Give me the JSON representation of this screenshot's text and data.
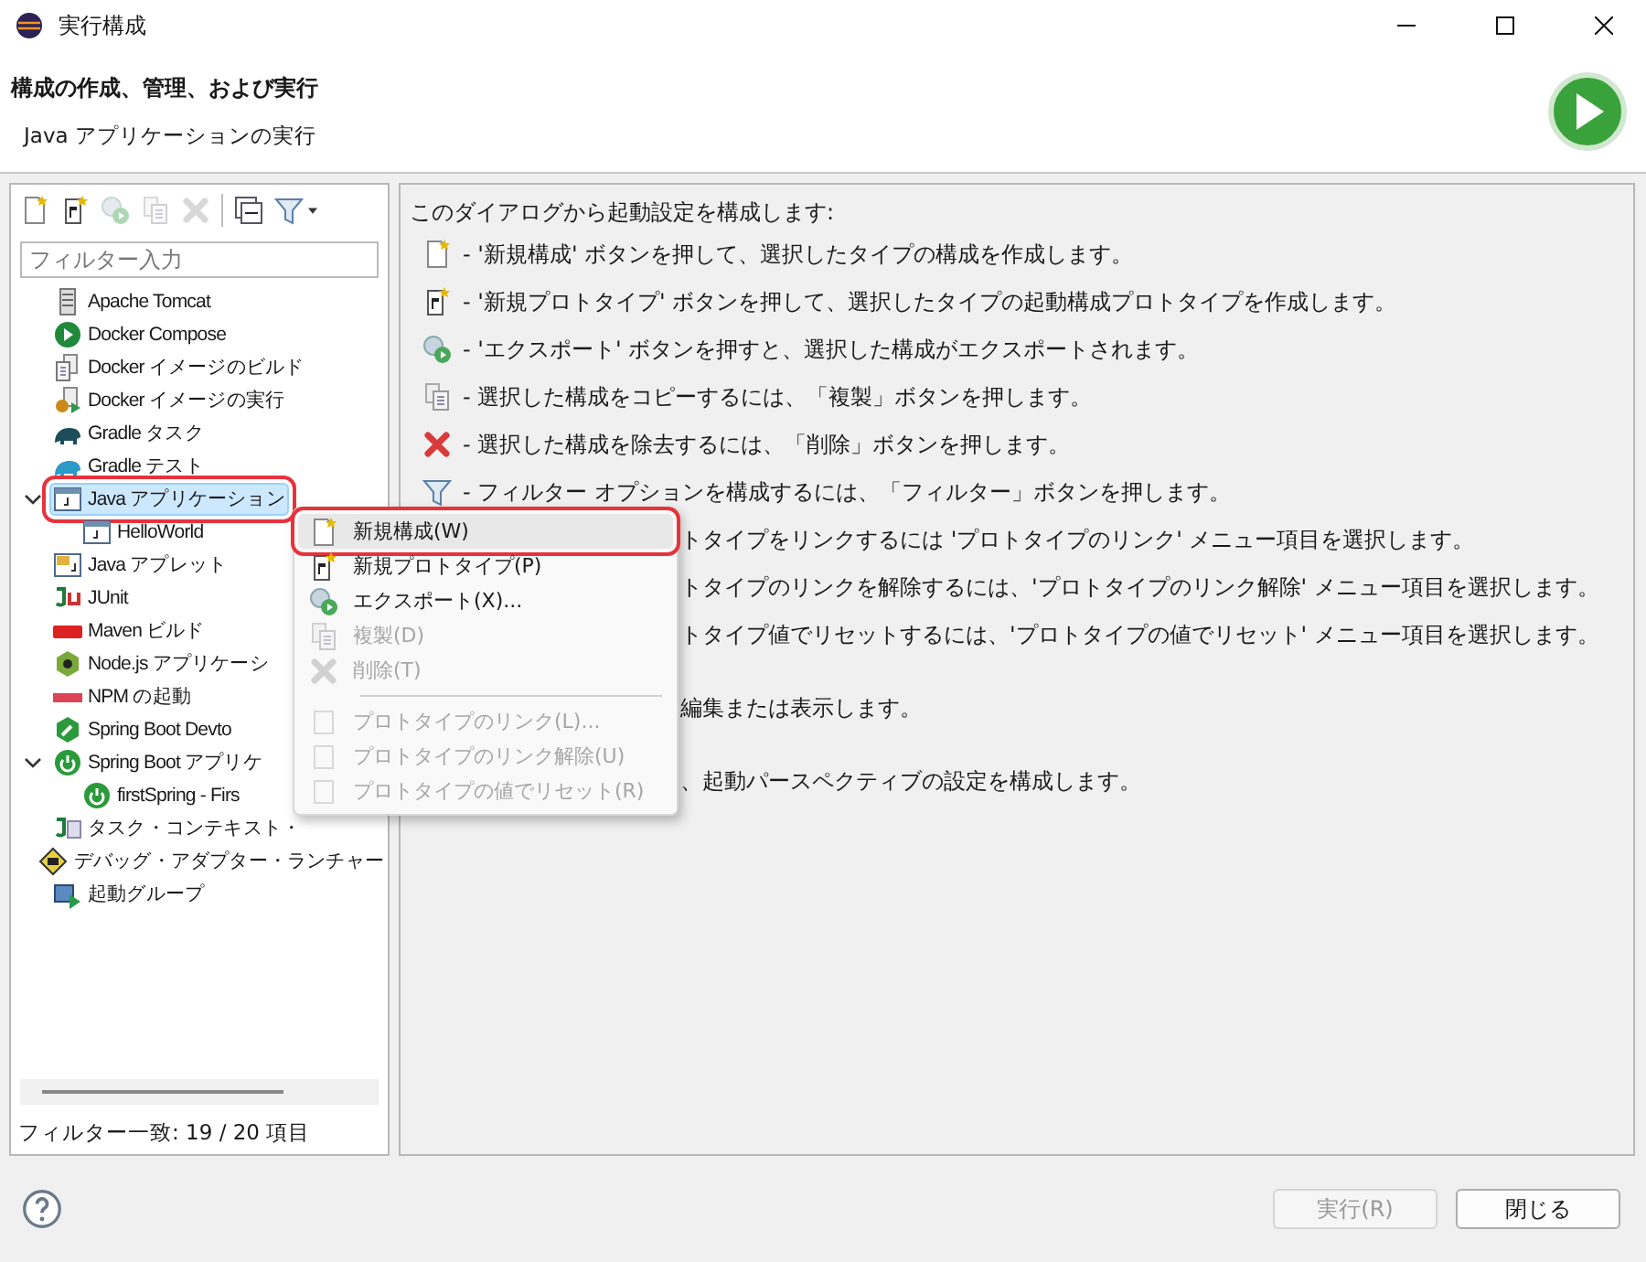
{
  "window": {
    "title": "実行構成"
  },
  "header": {
    "title": "構成の作成、管理、および実行",
    "subtitle": "Java アプリケーションの実行"
  },
  "toolbar": [
    {
      "disabled": false
    },
    {
      "disabled": false
    },
    {
      "disabled": true
    },
    {
      "disabled": true
    },
    {
      "disabled": true
    },
    {
      "disabled": false
    },
    {
      "disabled": false
    }
  ],
  "filter": {
    "placeholder": "フィルター入力"
  },
  "tree": [
    {
      "label": "Apache Tomcat",
      "selected": false,
      "highlighted": false
    },
    {
      "label": "Docker Compose",
      "selected": false,
      "highlighted": false
    },
    {
      "label": "Docker イメージのビルド",
      "selected": false,
      "highlighted": false
    },
    {
      "label": "Docker イメージの実行",
      "selected": false,
      "highlighted": false
    },
    {
      "label": "Gradle タスク",
      "selected": false,
      "highlighted": false
    },
    {
      "label": "Gradle テスト",
      "selected": false,
      "highlighted": false
    },
    {
      "label": "Java アプリケーション",
      "selected": true,
      "highlighted": true,
      "expanded": true,
      "children": [
        {
          "label": "HelloWorld",
          "selected": false,
          "highlighted": false
        }
      ]
    },
    {
      "label": "Java アプレット",
      "selected": false,
      "highlighted": false
    },
    {
      "label": "JUnit",
      "selected": false,
      "highlighted": false
    },
    {
      "label": "Maven ビルド",
      "selected": false,
      "highlighted": false
    },
    {
      "label": "Node.js アプリケーシ",
      "selected": false,
      "highlighted": false
    },
    {
      "label": "NPM の起動",
      "selected": false,
      "highlighted": false
    },
    {
      "label": "Spring Boot Devto",
      "selected": false,
      "highlighted": false
    },
    {
      "label": "Spring Boot アプリケ",
      "selected": false,
      "highlighted": false,
      "expanded": true,
      "children": [
        {
          "label": "firstSpring - Firs",
          "selected": false,
          "highlighted": false
        }
      ]
    },
    {
      "label": "タスク・コンテキスト・",
      "selected": false,
      "highlighted": false
    },
    {
      "label": "デバッグ・アダプター・ランチャー",
      "selected": false,
      "highlighted": false
    },
    {
      "label": "起動グループ",
      "selected": false,
      "highlighted": false
    }
  ],
  "filter_status": "フィルター一致: 19 / 20 項目",
  "help": {
    "intro": "このダイアログから起動設定を構成します:",
    "rows": [
      {
        "kind": "icon",
        "text": "- '新規構成' ボタンを押して、選択したタイプの構成を作成します。"
      },
      {
        "kind": "icon",
        "text": "- '新規プロトタイプ' ボタンを押して、選択したタイプの起動構成プロトタイプを作成します。"
      },
      {
        "kind": "icon",
        "text": "- 'エクスポート' ボタンを押すと、選択した構成がエクスポートされます。"
      },
      {
        "kind": "icon",
        "text": "- 選択した構成をコピーするには、「複製」ボタンを押します。"
      },
      {
        "kind": "icon",
        "text": "- 選択した構成を除去するには、「削除」ボタンを押します。"
      },
      {
        "kind": "icon",
        "text": "- フィルター オプションを構成するには、「フィルター」ボタンを押します。"
      },
      {
        "kind": "covered",
        "text": "トタイプをリンクするには 'プロトタイプのリンク' メニュー項目を選択します。"
      },
      {
        "kind": "covered",
        "text": "トタイプのリンクを解除するには、'プロトタイプのリンク解除' メニュー項目を選択します。"
      },
      {
        "kind": "covered",
        "text": "トタイプ値でリセットするには、'プロトタイプの値でリセット' メニュー項目を選択します。"
      },
      {
        "kind": "paragraph",
        "text": "編集または表示します。"
      },
      {
        "kind": "paragraph",
        "text": "、起動パースペクティブの設定を構成します。"
      }
    ]
  },
  "context_menu": [
    {
      "kind": "item",
      "label": "新規構成(W)",
      "disabled": false,
      "selected": true,
      "highlighted": true
    },
    {
      "kind": "item",
      "label": "新規プロトタイプ(P)",
      "disabled": false,
      "selected": false,
      "highlighted": false
    },
    {
      "kind": "item",
      "label": "エクスポート(X)...",
      "disabled": false,
      "selected": false,
      "highlighted": false
    },
    {
      "kind": "item",
      "label": "複製(D)",
      "disabled": true,
      "selected": false,
      "highlighted": false
    },
    {
      "kind": "item",
      "label": "削除(T)",
      "disabled": true,
      "selected": false,
      "highlighted": false
    },
    {
      "kind": "separator"
    },
    {
      "kind": "item",
      "label": "プロトタイプのリンク(L)...",
      "disabled": true,
      "selected": false,
      "highlighted": false
    },
    {
      "kind": "item",
      "label": "プロトタイプのリンク解除(U)",
      "disabled": true,
      "selected": false,
      "highlighted": false
    },
    {
      "kind": "item",
      "label": "プロトタイプの値でリセット(R)",
      "disabled": true,
      "selected": false,
      "highlighted": false
    }
  ],
  "buttons": [
    {
      "label": "実行(R)",
      "disabled": true
    },
    {
      "label": "閉じる",
      "disabled": false
    }
  ]
}
